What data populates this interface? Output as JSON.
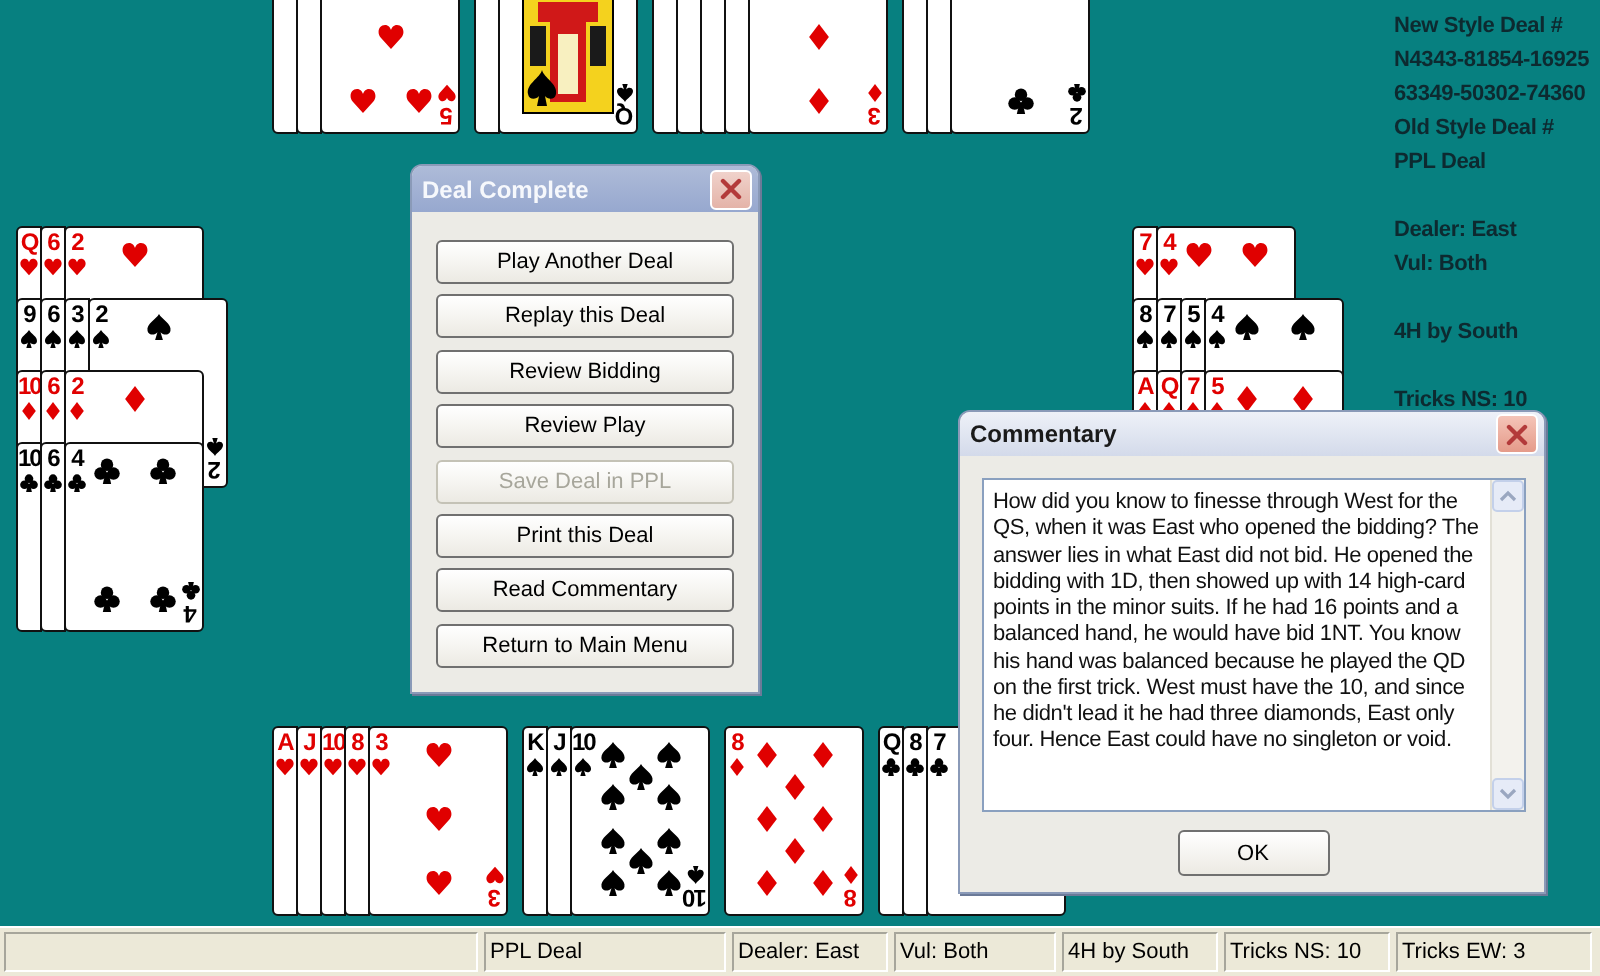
{
  "info": [
    {
      "lines": [
        "New Style Deal #",
        "N4343-81854-16925",
        "63349-50302-74360",
        "Old Style Deal #",
        "PPL Deal"
      ]
    },
    {
      "lines": [
        "Dealer: East",
        "Vul: Both"
      ]
    },
    {
      "lines": [
        "4H by South"
      ]
    },
    {
      "lines": [
        "Tricks NS: 10"
      ]
    }
  ],
  "hands": {
    "north": [
      {
        "kind": "hearts",
        "cards": [
          {
            "kind": "edge"
          },
          {
            "kind": "edge"
          },
          {
            "kind": "card",
            "corner_rank": "5"
          }
        ]
      },
      {
        "kind": "spades",
        "cards": [
          {
            "kind": "edge"
          },
          {
            "kind": "court",
            "corner_rank": "Q"
          }
        ]
      },
      {
        "kind": "diamonds",
        "cards": [
          {
            "kind": "edge"
          },
          {
            "kind": "edge"
          },
          {
            "kind": "edge"
          },
          {
            "kind": "edge"
          },
          {
            "kind": "card",
            "corner_rank": "3"
          }
        ]
      },
      {
        "kind": "clubs",
        "cards": [
          {
            "kind": "edge"
          },
          {
            "kind": "edge"
          },
          {
            "kind": "card",
            "corner_rank": "2"
          }
        ]
      }
    ],
    "west": [
      {
        "kind": "hearts",
        "cards": [
          {
            "kind": "card",
            "rank": "Q"
          },
          {
            "kind": "card",
            "rank": "6"
          },
          {
            "kind": "card",
            "rank": "2"
          }
        ]
      },
      {
        "kind": "spades",
        "cards": [
          {
            "kind": "card",
            "rank": "9"
          },
          {
            "kind": "card",
            "rank": "6"
          },
          {
            "kind": "card",
            "rank": "3"
          },
          {
            "kind": "card",
            "rank": "2",
            "corner_rank": "2"
          }
        ]
      },
      {
        "kind": "diamonds",
        "cards": [
          {
            "kind": "card",
            "rank": "10"
          },
          {
            "kind": "card",
            "rank": "6"
          },
          {
            "kind": "card",
            "rank": "2"
          }
        ]
      },
      {
        "kind": "clubs",
        "cards": [
          {
            "kind": "card",
            "rank": "10"
          },
          {
            "kind": "card",
            "rank": "6"
          },
          {
            "kind": "card",
            "rank": "4",
            "corner_rank": "4"
          }
        ]
      }
    ],
    "east": [
      {
        "kind": "hearts",
        "cards": [
          {
            "kind": "card",
            "rank": "7"
          },
          {
            "kind": "card",
            "rank": "4"
          }
        ]
      },
      {
        "kind": "spades",
        "cards": [
          {
            "kind": "card",
            "rank": "8"
          },
          {
            "kind": "card",
            "rank": "7"
          },
          {
            "kind": "card",
            "rank": "5"
          },
          {
            "kind": "card",
            "rank": "4"
          }
        ]
      },
      {
        "kind": "diamonds",
        "cards": [
          {
            "kind": "card",
            "rank": "A"
          },
          {
            "kind": "card",
            "rank": "Q"
          },
          {
            "kind": "card",
            "rank": "7"
          },
          {
            "kind": "card",
            "rank": "5"
          }
        ]
      }
    ],
    "south": [
      {
        "kind": "hearts",
        "cards": [
          {
            "kind": "card",
            "rank": "A"
          },
          {
            "kind": "card",
            "rank": "J"
          },
          {
            "kind": "card",
            "rank": "10"
          },
          {
            "kind": "card",
            "rank": "8"
          },
          {
            "kind": "card",
            "rank": "3",
            "corner_rank": "3"
          }
        ]
      },
      {
        "kind": "spades",
        "cards": [
          {
            "kind": "card",
            "rank": "K"
          },
          {
            "kind": "card",
            "rank": "J"
          },
          {
            "kind": "card",
            "rank": "10",
            "corner_rank": "10"
          }
        ]
      },
      {
        "kind": "diamonds",
        "cards": [
          {
            "kind": "card",
            "rank": "8",
            "corner_rank": "8"
          }
        ]
      },
      {
        "kind": "clubs",
        "cards": [
          {
            "kind": "card",
            "rank": "Q"
          },
          {
            "kind": "card",
            "rank": "8"
          },
          {
            "kind": "covered",
            "rank": "7"
          }
        ]
      }
    ]
  },
  "deal_complete_dialog": {
    "title": "Deal Complete",
    "active": false,
    "buttons": [
      {
        "label": "Play Another Deal",
        "disabled": false
      },
      {
        "label": "Replay this Deal",
        "disabled": false
      },
      {
        "label": "Review Bidding",
        "disabled": false
      },
      {
        "label": "Review Play",
        "disabled": false
      },
      {
        "label": "Save Deal in PPL",
        "disabled": true
      },
      {
        "label": "Print this Deal",
        "disabled": false
      },
      {
        "label": "Read Commentary",
        "disabled": false
      },
      {
        "label": "Return to Main Menu",
        "disabled": false
      }
    ]
  },
  "commentary_dialog": {
    "title": "Commentary",
    "active": true,
    "text": "How did you know to finesse through West for the QS, when it was East who opened the bidding? The answer lies in what East did not bid. He opened the bidding with 1D, then showed up with 14 high-card points in the minor suits. If he had 16 points and a balanced hand, he would have bid 1NT. You know his hand was balanced because he played the QD on the first trick. West must have the 10, and since he didn't lead it he had three diamonds, East only four. Hence East could have no singleton or void.",
    "button": "OK"
  },
  "status_bar": [
    "PPL Deal",
    "Dealer: East",
    "Vul: Both",
    "4H by South",
    "Tricks NS: 10",
    "Tricks EW: 3"
  ]
}
